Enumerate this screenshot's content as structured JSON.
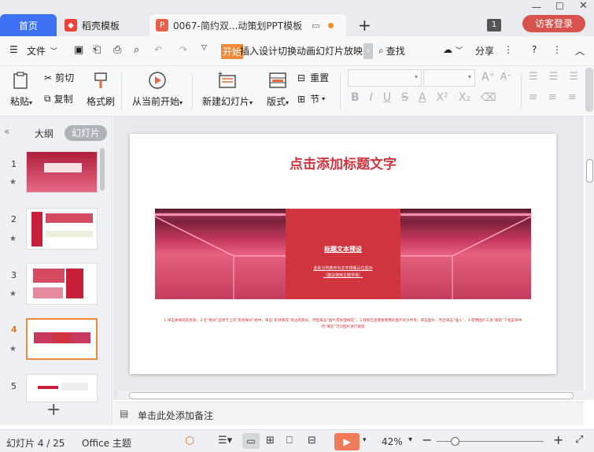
{
  "tabs": {
    "home": "首页",
    "daoke": "稻壳模板",
    "doc": "0067-简约双...动策划PPT模板"
  },
  "window": {
    "doc_count": "1",
    "login": "访客登录"
  },
  "menu": {
    "file": "文件",
    "items": [
      "开始",
      "插入",
      "设计",
      "切换",
      "动画",
      "幻灯片放映"
    ],
    "find": "查找",
    "share": "分享"
  },
  "ribbon": {
    "paste": "粘贴",
    "cut": "剪切",
    "copy": "复制",
    "format_painter": "格式刷",
    "from_current": "从当前开始",
    "new_slide": "新建幻灯片",
    "layout": "版式",
    "reset": "重置",
    "section": "节"
  },
  "panel": {
    "outline": "大纲",
    "slides": "幻灯片"
  },
  "thumbs": [
    "1",
    "2",
    "3",
    "4",
    "5"
  ],
  "slide": {
    "title": "点击添加标题文字",
    "center_title": "标题文本预设",
    "center_sub1": "此处分列表作为文字排版占位显示",
    "center_sub2": "（建议使用主题字体）",
    "body": "1.单击要填充的形状，2.在“格式”选项卡上的“形状样式”组中，单击“形状填充”旁边的箭头，然后单击“图片或纹理填充”，3.找到包含需要使用的图片的文件夹，单击图片，然后单击“插入”，4.使用图片工具“裁剪”下拉菜单中的“填充”可对图片进行裁剪"
  },
  "notes": "单击此处添加备注",
  "status": {
    "slide_info": "幻灯片 4 / 25",
    "theme": "Office 主题",
    "zoom": "42%"
  },
  "colors": {
    "accent": "#3d72f4",
    "brand": "#d0343f",
    "start_tab": "#f08a3a"
  }
}
